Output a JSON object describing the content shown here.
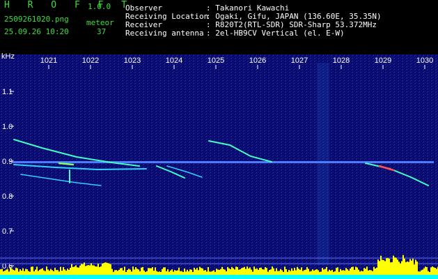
{
  "header": {
    "app_name": "H R O F F T",
    "version": "1.0.0",
    "filename": "2509261020.png",
    "datetime": "25.09.26 10:20",
    "meteor_label": "meteor",
    "meteor_count": "37",
    "info_labels": [
      "Observer",
      "Receiving Location",
      "Receiver",
      "Receiving antenna"
    ],
    "info_values": [
      ": Takanori Kawachi",
      ": Ogaki, Gifu, JAPAN (136.60E, 35.35N)",
      ": R820T2(RTL-SDR) SDR-Sharp 53.372MHz",
      ": 2el-HB9CV Vertical (el. E-W)"
    ]
  },
  "spectrogram": {
    "unit_label": "kHz",
    "time_labels": [
      "1021",
      "1022",
      "1023",
      "1024",
      "1025",
      "1026",
      "1027",
      "1028",
      "1029",
      "1030"
    ],
    "freq_labels": [
      "1.1",
      "1.0",
      "0.9",
      "0.8",
      "0.7",
      "0.6"
    ],
    "colors": {
      "background": "#0a0a6e",
      "carrier": "#4060ff",
      "meteor": "#40ffc0",
      "bar": "#ffff00",
      "bar_base": "#00ffff",
      "label": "#ffffff"
    }
  }
}
